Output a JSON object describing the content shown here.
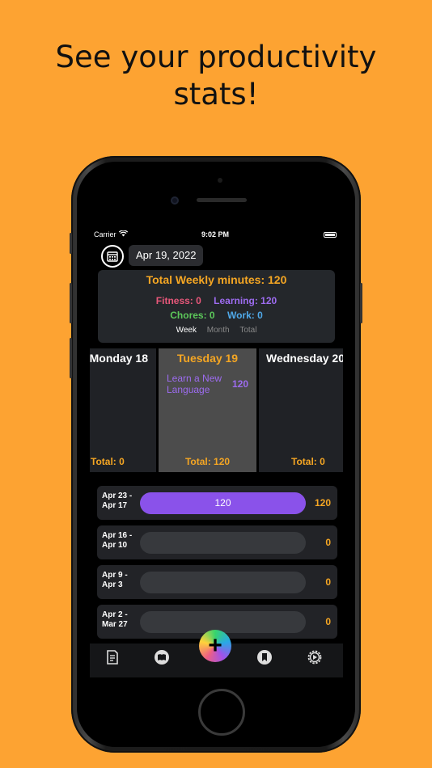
{
  "headline": {
    "line1": "See your productivity",
    "line2": "stats!"
  },
  "status_bar": {
    "carrier": "Carrier",
    "time": "9:02 PM"
  },
  "date_picker": {
    "date": "Apr 19, 2022",
    "icon": "calendar-icon"
  },
  "summary": {
    "title": "Total Weekly minutes: 120",
    "categories": [
      {
        "label": "Fitness: 0",
        "color": "#E8577A"
      },
      {
        "label": "Learning: 120",
        "color": "#9D6CF0"
      },
      {
        "label": "Chores: 0",
        "color": "#5CC85A"
      },
      {
        "label": "Work: 0",
        "color": "#4FA8E8"
      }
    ],
    "tabs": [
      "Week",
      "Month",
      "Total"
    ],
    "active_tab": "Week"
  },
  "days": [
    {
      "title": "Monday 18",
      "total": "Total: 0"
    },
    {
      "title": "Tuesday 19",
      "total": "Total: 120",
      "task": {
        "name": "Learn a New Language",
        "minutes": "120"
      }
    },
    {
      "title": "Wednesday 20",
      "total": "Total: 0"
    }
  ],
  "weeks": [
    {
      "range_line1": "Apr 23 -",
      "range_line2": "Apr 17",
      "minutes": 120,
      "bar_label": "120",
      "value": "120",
      "fill_fraction": 1.0
    },
    {
      "range_line1": "Apr 16 -",
      "range_line2": "Apr 10",
      "minutes": 0,
      "bar_label": "",
      "value": "0",
      "fill_fraction": 0
    },
    {
      "range_line1": "Apr 9 -",
      "range_line2": "Apr 3",
      "minutes": 0,
      "bar_label": "",
      "value": "0",
      "fill_fraction": 0
    },
    {
      "range_line1": "Apr 2 -",
      "range_line2": "Mar 27",
      "minutes": 0,
      "bar_label": "",
      "value": "0",
      "fill_fraction": 0
    }
  ],
  "tabbar": {
    "icons": [
      "notes-icon",
      "book-icon",
      "add-icon",
      "bookmark-icon",
      "settings-icon"
    ]
  },
  "colors": {
    "accent": "#F5A623",
    "background": "#FDA332",
    "learning": "#9D6CF0"
  }
}
